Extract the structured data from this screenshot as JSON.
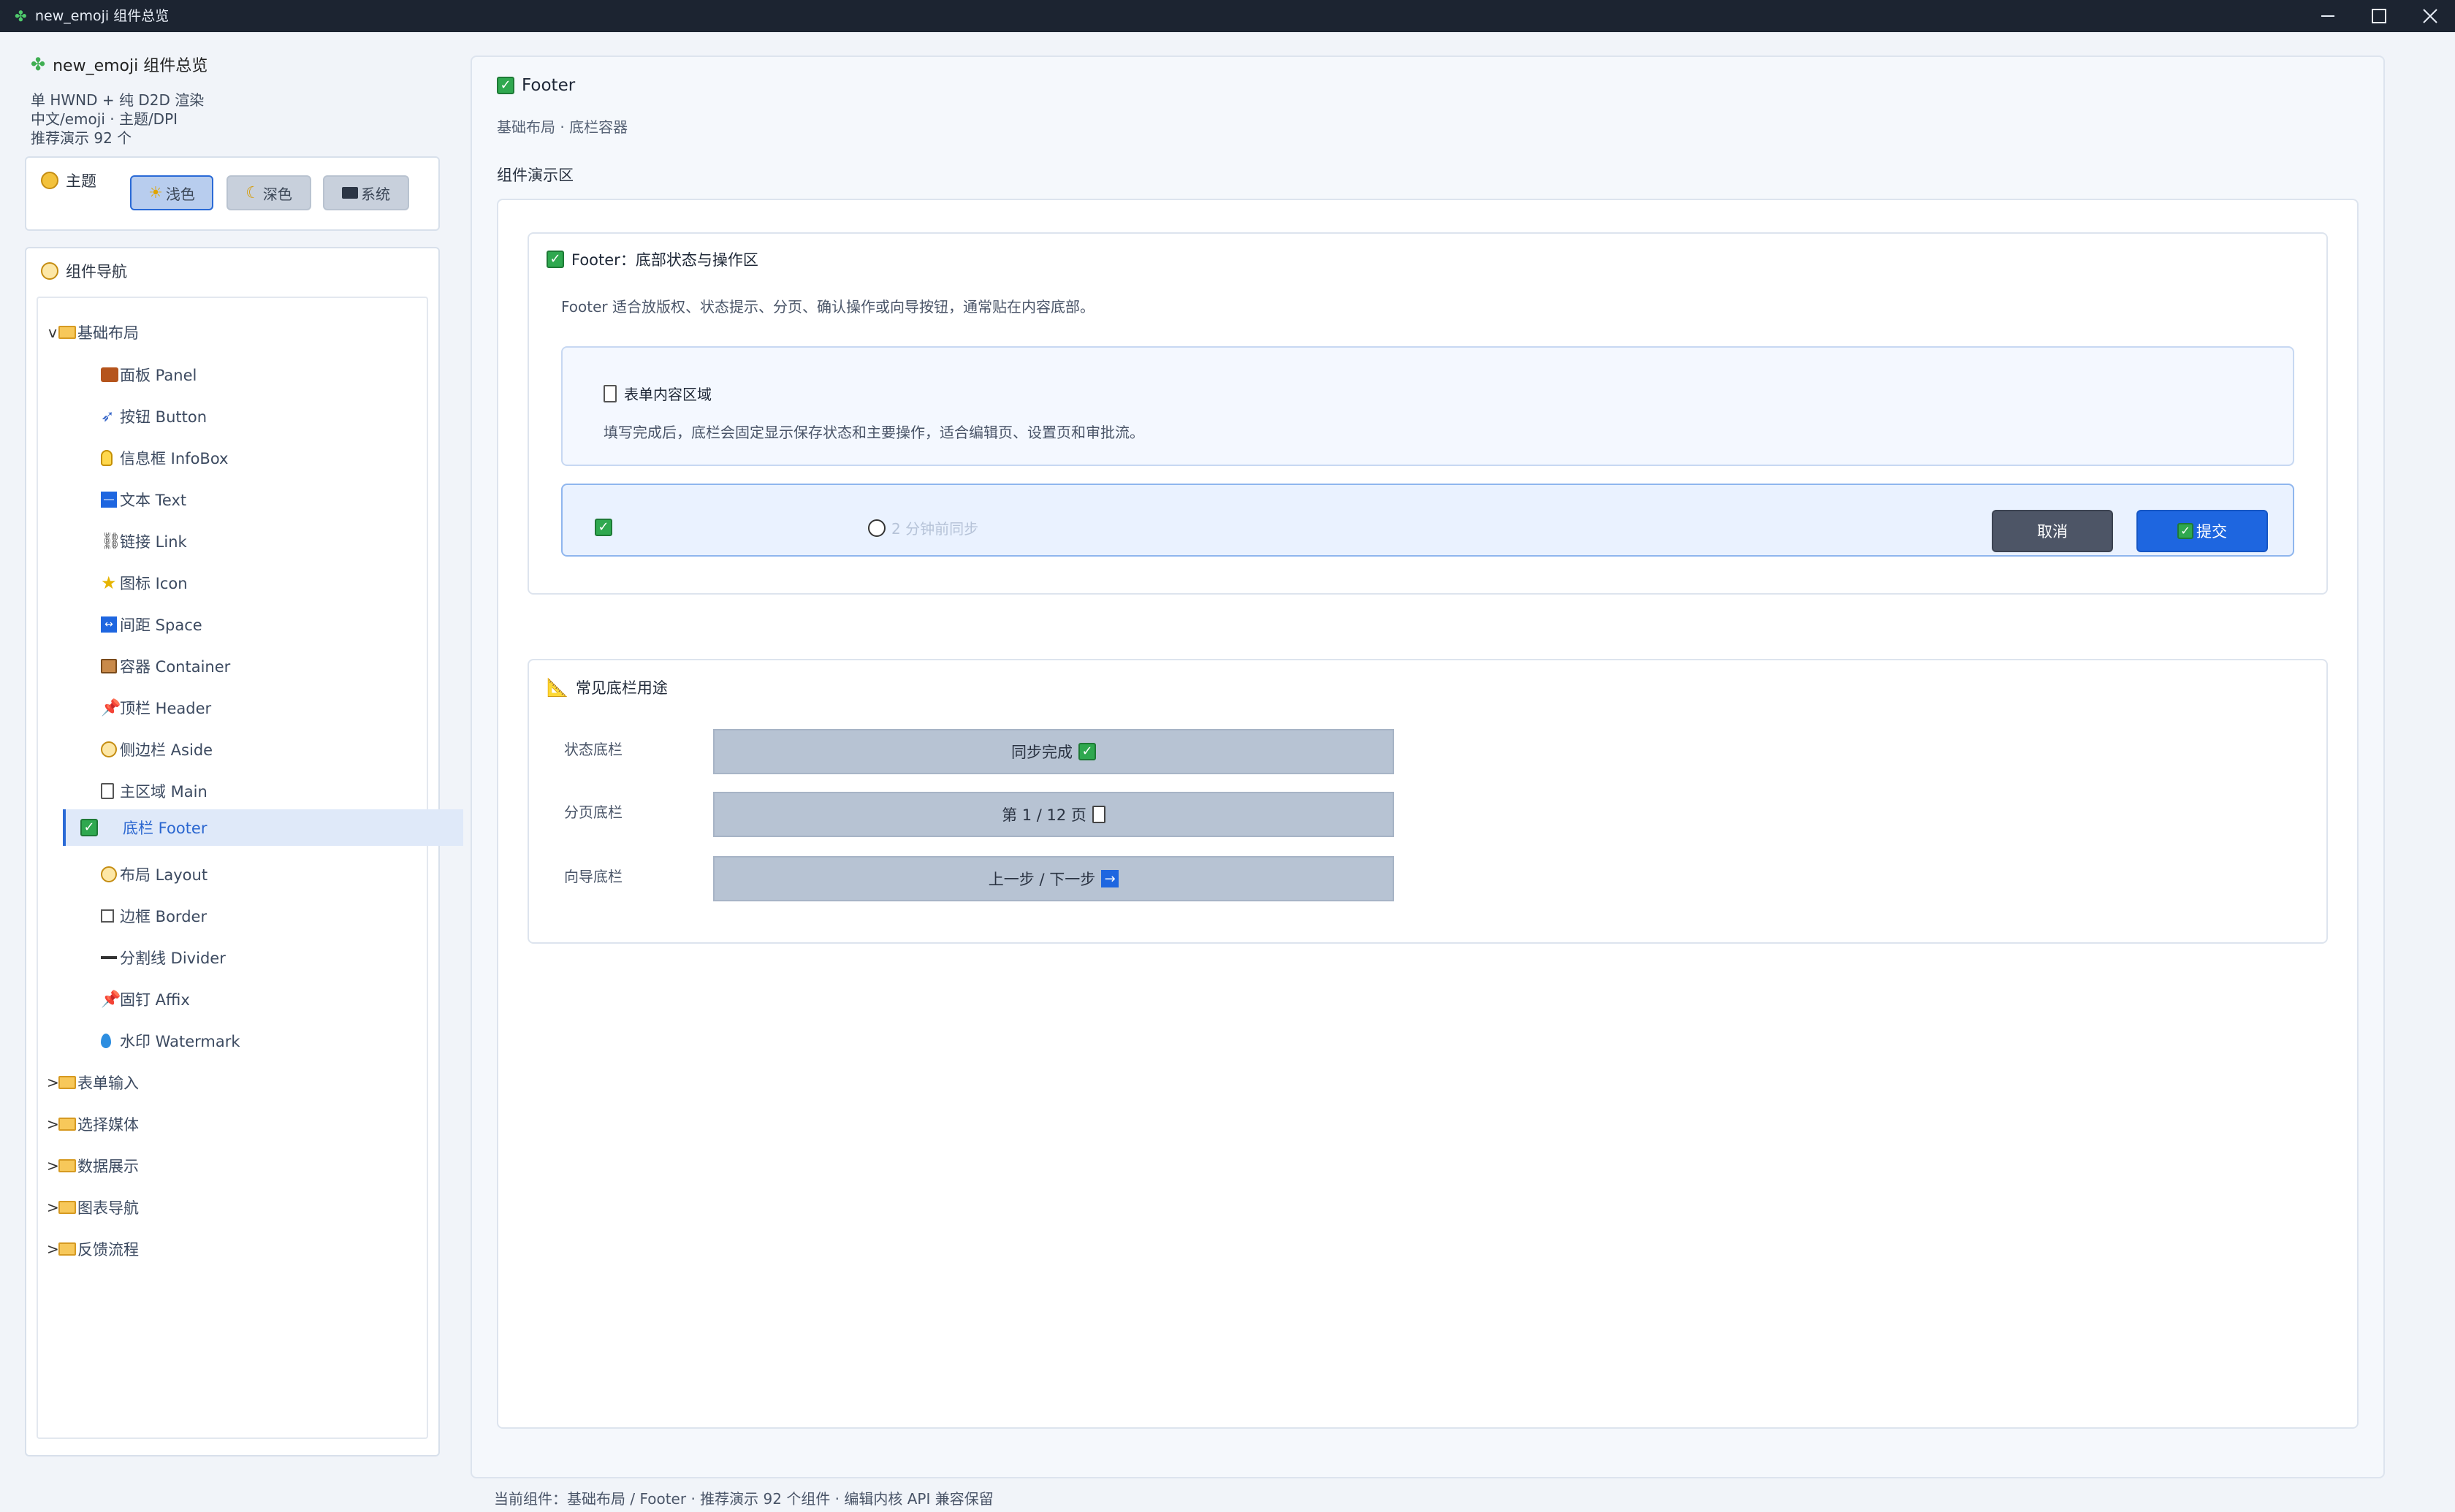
{
  "window": {
    "title": "new_emoji 组件总览"
  },
  "sidebar": {
    "app_title": "new_emoji 组件总览",
    "info_lines": [
      "单 HWND + 纯 D2D 渲染",
      "中文/emoji · 主题/DPI",
      "推荐演示 92 个"
    ],
    "theme": {
      "label": "主题",
      "buttons": [
        {
          "label": "浅色",
          "icon": "sun-icon",
          "active": true
        },
        {
          "label": "深色",
          "icon": "moon-icon",
          "active": false
        },
        {
          "label": "系统",
          "icon": "laptop-icon",
          "active": false
        }
      ]
    },
    "nav": {
      "title": "组件导航",
      "tree": [
        {
          "label": "基础布局",
          "expanded": true,
          "children": [
            {
              "label": "面板 Panel",
              "icon": "panel-icon"
            },
            {
              "label": "按钮 Button",
              "icon": "rocket-icon"
            },
            {
              "label": "信息框 InfoBox",
              "icon": "bulb-icon"
            },
            {
              "label": "文本 Text",
              "icon": "text-icon"
            },
            {
              "label": "链接 Link",
              "icon": "link-icon"
            },
            {
              "label": "图标 Icon",
              "icon": "star-icon"
            },
            {
              "label": "间距 Space",
              "icon": "space-icon"
            },
            {
              "label": "容器 Container",
              "icon": "container-icon"
            },
            {
              "label": "顶栏 Header",
              "icon": "pin-icon"
            },
            {
              "label": "侧边栏 Aside",
              "icon": "clock-icon"
            },
            {
              "label": "主区域 Main",
              "icon": "page-icon"
            },
            {
              "label": "底栏 Footer",
              "icon": "checkbox-icon",
              "active": true
            },
            {
              "label": "布局 Layout",
              "icon": "clock-icon"
            },
            {
              "label": "边框 Border",
              "icon": "border-icon"
            },
            {
              "label": "分割线 Divider",
              "icon": "divider-icon"
            },
            {
              "label": "固钉 Affix",
              "icon": "pin-icon"
            },
            {
              "label": "水印 Watermark",
              "icon": "droplet-icon"
            }
          ]
        },
        {
          "label": "表单输入",
          "expanded": false
        },
        {
          "label": "选择媒体",
          "expanded": false
        },
        {
          "label": "数据展示",
          "expanded": false
        },
        {
          "label": "图表导航",
          "expanded": false
        },
        {
          "label": "反馈流程",
          "expanded": false
        }
      ]
    }
  },
  "main": {
    "title": "Footer",
    "subtitle": "基础布局 · 底栏容器",
    "demo_label": "组件演示区",
    "section1": {
      "title": "Footer：底部状态与操作区",
      "description": "Footer 适合放版权、状态提示、分页、确认操作或向导按钮，通常贴在内容底部。",
      "form_title": "表单内容区域",
      "form_desc": "填写完成后，底栏会固定显示保存状态和主要操作，适合编辑页、设置页和审批流。",
      "footer_status": "2 分钟前同步",
      "cancel_label": "取消",
      "submit_label": "提交"
    },
    "section2": {
      "title": "常见底栏用途",
      "rows": [
        {
          "label": "状态底栏",
          "value": "同步完成",
          "icon": "checkbox-icon"
        },
        {
          "label": "分页底栏",
          "value": "第 1 / 12 页",
          "icon": "page-icon"
        },
        {
          "label": "向导底栏",
          "value": "上一步 / 下一步",
          "icon": "arrow-right-icon"
        }
      ]
    }
  },
  "statusbar": {
    "text": "当前组件：基础布局 / Footer · 推荐演示 92 个组件 · 编辑内核 API 兼容保留"
  },
  "colors": {
    "accent": "#1e66e0",
    "success": "#2fa84f",
    "titlebar": "#1c2431"
  }
}
